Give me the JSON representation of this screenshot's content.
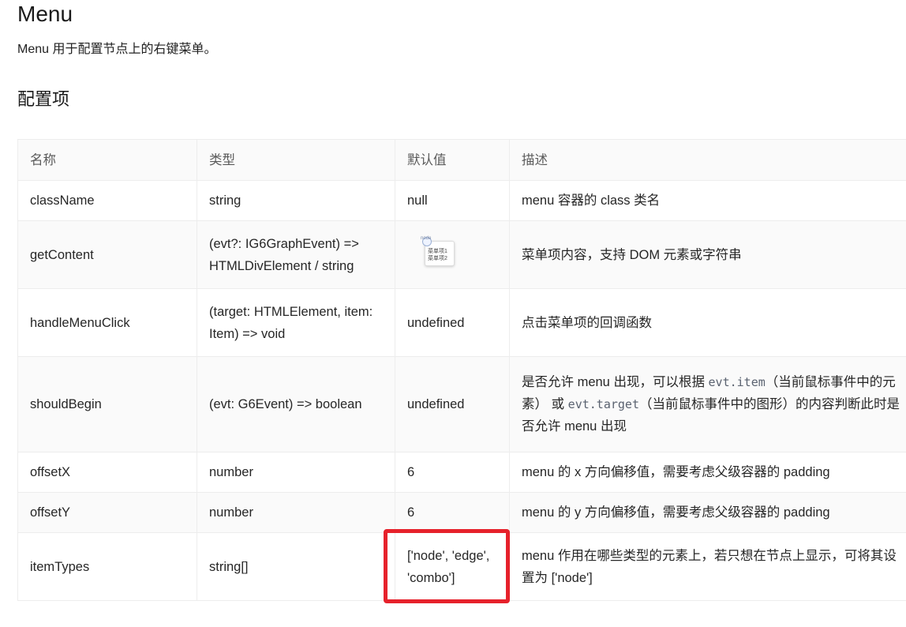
{
  "page": {
    "title": "Menu",
    "subtitle": "Menu 用于配置节点上的右键菜单。",
    "section": "配置项"
  },
  "table": {
    "headers": [
      "名称",
      "类型",
      "默认值",
      "描述"
    ],
    "rows": [
      {
        "name": "className",
        "type": "string",
        "default": "null",
        "desc": "menu 容器的 class 类名"
      },
      {
        "name": "getContent",
        "type": "(evt?: IG6GraphEvent) => HTMLDivElement / string",
        "default": "",
        "desc": "菜单项内容，支持 DOM 元素或字符串"
      },
      {
        "name": "handleMenuClick",
        "type": "(target: HTMLElement, item: Item) => void",
        "default": "undefined",
        "desc": "点击菜单项的回调函数"
      },
      {
        "name": "shouldBegin",
        "type": "(evt: G6Event) => boolean",
        "default": "undefined",
        "desc_parts": [
          "是否允许 menu 出现，可以根据 ",
          "evt.item",
          "（当前鼠标事件中的元素） 或 ",
          "evt.target",
          "（当前鼠标事件中的图形）的内容判断此时是否允许 menu 出现"
        ]
      },
      {
        "name": "offsetX",
        "type": "number",
        "default": "6",
        "desc": "menu 的 x 方向偏移值，需要考虑父级容器的 padding"
      },
      {
        "name": "offsetY",
        "type": "number",
        "default": "6",
        "desc": "menu 的 y 方向偏移值，需要考虑父级容器的 padding"
      },
      {
        "name": "itemTypes",
        "type": "string[]",
        "default": "['node', 'edge', 'combo']",
        "desc": "menu 作用在哪些类型的元素上，若只想在节点上显示，可将其设置为 ['node']"
      }
    ]
  },
  "thumbnail": {
    "line1": "菜单项1",
    "line2": "菜单项2",
    "pre": "node"
  },
  "colors": {
    "highlight": "#e6212b",
    "header_bg": "#fafafa",
    "border": "#ededed"
  }
}
